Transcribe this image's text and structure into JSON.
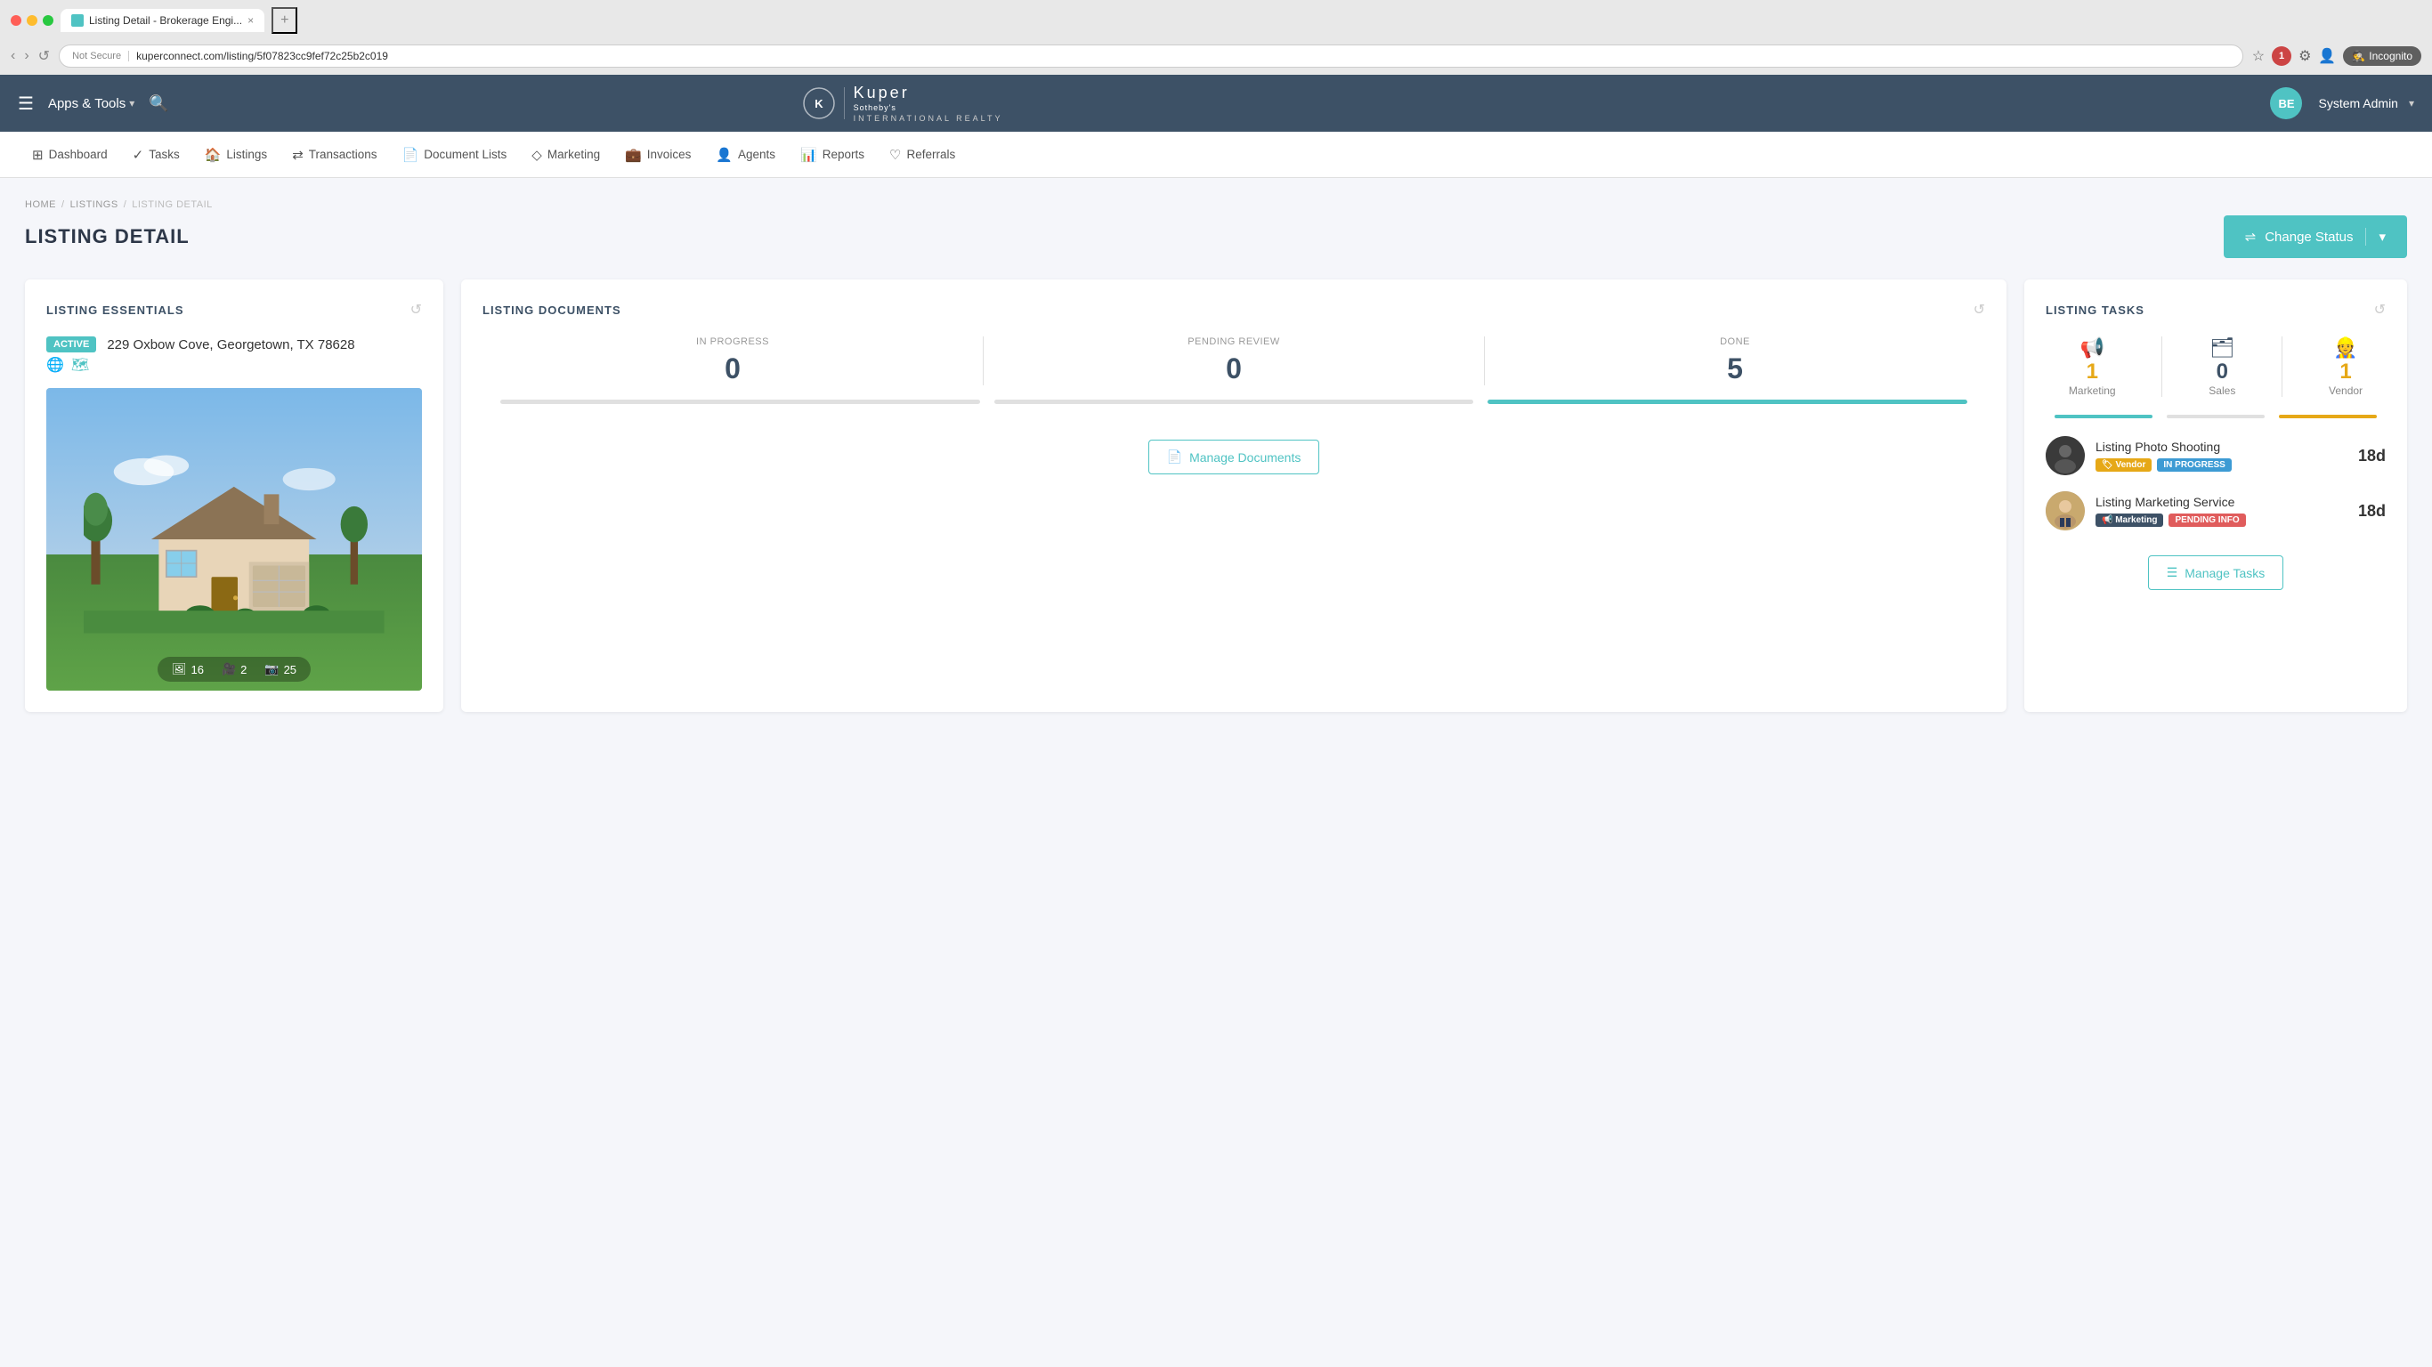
{
  "browser": {
    "tab_title": "Listing Detail - Brokerage Engi...",
    "url_not_secure": "Not Secure",
    "url": "kuperconnect.com/listing/5f07823cc9fef72c25b2c019",
    "incognito_label": "Incognito",
    "tab_close": "×",
    "tab_add": "+"
  },
  "header": {
    "menu_icon": "☰",
    "apps_tools_label": "Apps & Tools",
    "apps_tools_chevron": "▾",
    "logo_brand": "Kuper",
    "logo_tagline_1": "Sotheby's",
    "logo_tagline_2": "INTERNATIONAL REALTY",
    "user_initials": "BE",
    "user_name": "System Admin",
    "user_chevron": "▾"
  },
  "nav": {
    "items": [
      {
        "icon": "⊞",
        "label": "Dashboard"
      },
      {
        "icon": "✓",
        "label": "Tasks"
      },
      {
        "icon": "🏠",
        "label": "Listings"
      },
      {
        "icon": "⇌",
        "label": "Transactions"
      },
      {
        "icon": "📄",
        "label": "Document Lists"
      },
      {
        "icon": "◇",
        "label": "Marketing"
      },
      {
        "icon": "💼",
        "label": "Invoices"
      },
      {
        "icon": "👤",
        "label": "Agents"
      },
      {
        "icon": "📊",
        "label": "Reports"
      },
      {
        "icon": "♡",
        "label": "Referrals"
      }
    ]
  },
  "breadcrumb": {
    "home": "HOME",
    "listings": "LISTINGS",
    "detail": "LISTING DETAIL",
    "sep": "/"
  },
  "page": {
    "title": "LISTING DETAIL",
    "change_status_label": "Change Status",
    "change_status_icon": "⇌"
  },
  "listing_essentials": {
    "card_title": "LISTING ESSENTIALS",
    "status_badge": "ACTIVE",
    "address": "229 Oxbow Cove, Georgetown, TX 78628",
    "photo_count": "16",
    "video_count": "2",
    "tour_count": "25"
  },
  "listing_documents": {
    "card_title": "LISTING DOCUMENTS",
    "in_progress_label": "IN PROGRESS",
    "in_progress_value": "0",
    "pending_review_label": "PENDING REVIEW",
    "pending_review_value": "0",
    "done_label": "DONE",
    "done_value": "5",
    "manage_docs_icon": "📄",
    "manage_docs_label": "Manage Documents"
  },
  "listing_tasks": {
    "card_title": "LISTING TASKS",
    "marketing_count": "1",
    "marketing_label": "Marketing",
    "sales_count": "0",
    "sales_label": "Sales",
    "vendor_count": "1",
    "vendor_label": "Vendor",
    "tasks": [
      {
        "title": "Listing Photo Shooting",
        "badge1": "Vendor",
        "badge2": "IN PROGRESS",
        "days": "18d",
        "avatar_type": "dark"
      },
      {
        "title": "Listing Marketing Service",
        "badge1": "Marketing",
        "badge2": "PENDING INFO",
        "days": "18d",
        "avatar_type": "light"
      }
    ],
    "manage_tasks_icon": "☰",
    "manage_tasks_label": "Manage Tasks"
  },
  "colors": {
    "teal": "#4fc3c3",
    "navy": "#3d5166",
    "yellow": "#e6a817",
    "red": "#e05c5c",
    "blue": "#3d9bd4"
  }
}
